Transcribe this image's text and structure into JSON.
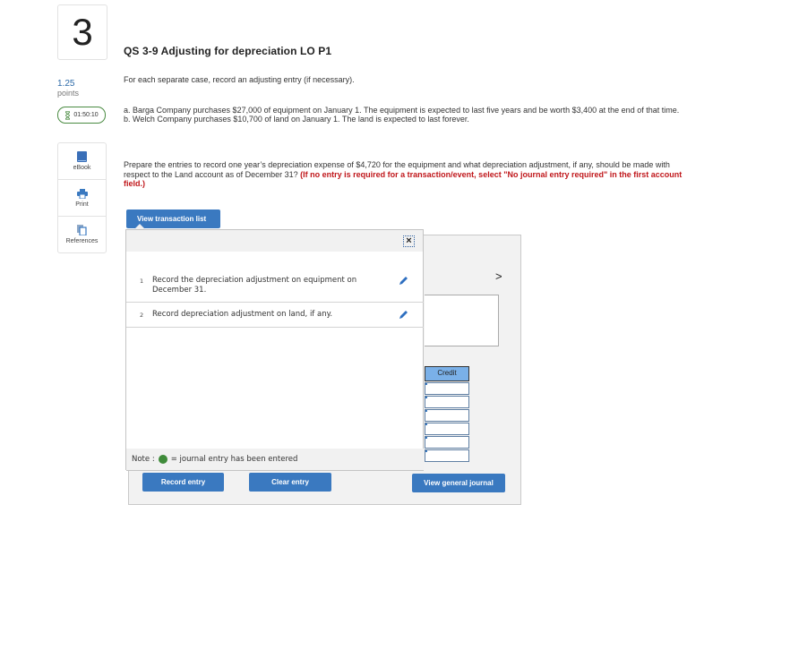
{
  "question": {
    "number": "3",
    "points_value": "1.25",
    "points_label": "points",
    "timer": "01:50:10",
    "title": "QS 3-9 Adjusting for depreciation LO P1",
    "intro": "For each separate case, record an adjusting entry (if necessary).",
    "cases": [
      {
        "label": "a.",
        "text": "Barga Company purchases $27,000 of equipment on January 1. The equipment is expected to last five years and be worth $3,400 at the end of that time."
      },
      {
        "label": "b.",
        "text": "Welch Company purchases $10,700 of land on January 1. The land is expected to last forever."
      }
    ],
    "prepare_text": "Prepare the entries to record one year’s depreciation expense of $4,720 for the equipment and what depreciation adjustment, if any, should be made with respect to the Land account as of December 31?",
    "prepare_note": "(If no entry is required for a transaction/event, select \"No journal entry required\" in the first account field.)"
  },
  "tools": [
    {
      "label": "eBook",
      "icon": "book-icon"
    },
    {
      "label": "Print",
      "icon": "printer-icon"
    },
    {
      "label": "References",
      "icon": "references-icon"
    }
  ],
  "transaction_list": {
    "button_label": "View transaction list",
    "close_label": "×",
    "items": [
      {
        "number": "1",
        "text": "Record the depreciation adjustment on equipment on December 31."
      },
      {
        "number": "2",
        "text": "Record depreciation adjustment on land, if any."
      }
    ],
    "note_prefix": "Note :",
    "note_suffix": "= journal entry has been entered"
  },
  "worksheet": {
    "next_label": ">",
    "credit_header": "Credit",
    "credit_values": [
      "",
      "",
      "",
      "",
      "",
      ""
    ]
  },
  "buttons": {
    "record_entry": "Record entry",
    "clear_entry": "Clear entry",
    "view_general_journal": "View general journal"
  },
  "colors": {
    "accent_blue": "#3a79c0",
    "instruction_red": "#c0171b",
    "entered_green": "#3f8b3a",
    "credit_header": "#7ab0e8"
  }
}
